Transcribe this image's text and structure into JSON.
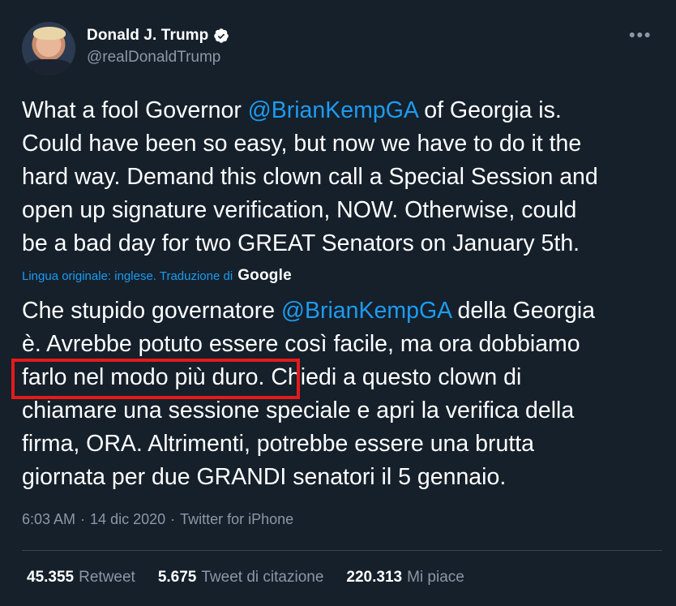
{
  "author": {
    "display_name": "Donald J. Trump",
    "handle": "@realDonaldTrump",
    "verified": true
  },
  "menu_icon": "more-horizontal-icon",
  "tweet": {
    "original_lines": [
      [
        "What a fool Governor ",
        "@BrianKempGA",
        " of Georgia is."
      ],
      [
        "Could have been so easy, but now we have to do it the"
      ],
      [
        "hard way. Demand this clown call a Special Session and"
      ],
      [
        "open up signature verification, NOW. Otherwise, could"
      ],
      [
        "be a bad day for two GREAT Senators on January 5th."
      ]
    ],
    "translation_note": "Lingua originale: inglese. Traduzione di",
    "translation_provider": "Google",
    "translated_lines": [
      [
        "Che stupido governatore ",
        "@BrianKempGA",
        " della Georgia"
      ],
      [
        "è. Avrebbe potuto essere così facile, ma ora dobbiamo"
      ],
      [
        "farlo nel modo più duro. Chiedi a questo clown di"
      ],
      [
        "chiamare una sessione speciale e apri la verifica della"
      ],
      [
        "firma, ORA. Altrimenti, potrebbe essere una brutta"
      ],
      [
        "giornata per due GRANDI senatori il 5 gennaio."
      ]
    ]
  },
  "meta": {
    "time": "6:03 AM",
    "date": "14 dic 2020",
    "source": "Twitter for iPhone",
    "separator": "·"
  },
  "stats": [
    {
      "count": "45.355",
      "label": "Retweet"
    },
    {
      "count": "5.675",
      "label": "Tweet di citazione"
    },
    {
      "count": "220.313",
      "label": "Mi piace"
    }
  ],
  "colors": {
    "background": "#15202b",
    "accent": "#1d9bf0",
    "muted": "#8b98a5",
    "highlight": "#e21b1b"
  }
}
